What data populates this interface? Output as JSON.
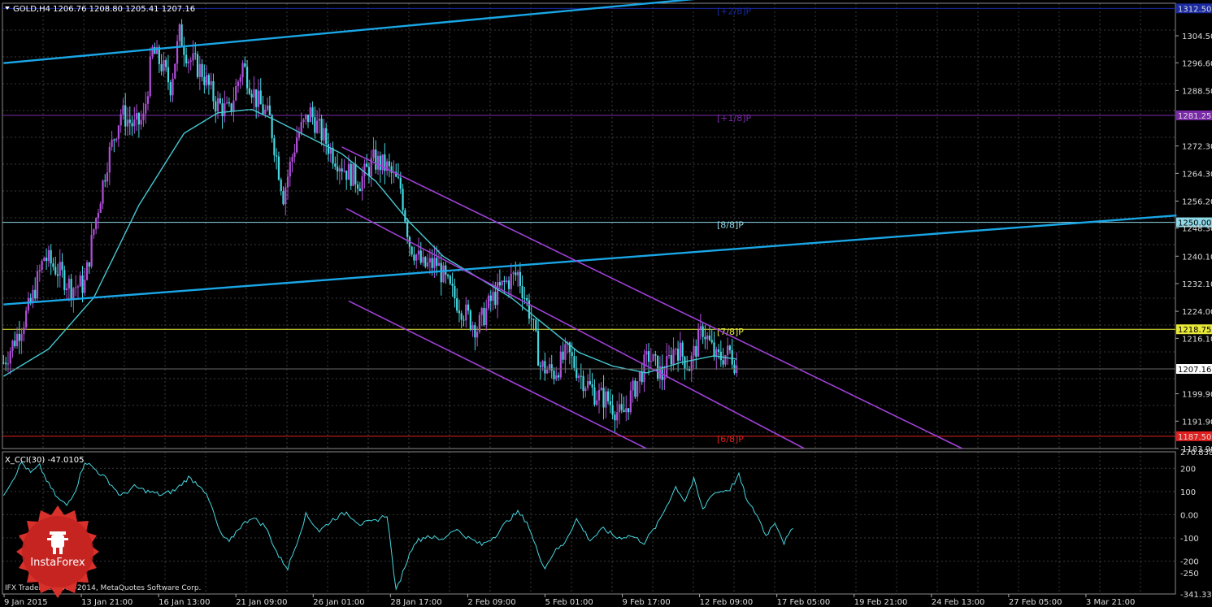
{
  "header": {
    "symbol_line": "GOLD,H4  1206.76 1208.80 1205.41 1207.16",
    "indicator_line": "X_CCI(30) -47.0105",
    "copyright": "IFX Trader, © 2001-2014, MetaQuotes Software Corp."
  },
  "logo": {
    "text": "InstaForex"
  },
  "colors": {
    "background": "#000000",
    "grid": "#3a3a3a",
    "bull_candle": "#b04fd8",
    "bear_candle": "#46d7e0",
    "moving_average": "#46c8d2",
    "trend_line": "#1aa6e6",
    "channel": "#a040d8",
    "cci": "#46d7e0",
    "level_1218": "#e8e83a",
    "level_1187": "#e02020",
    "level_1281": "#7a2aa8",
    "level_1312": "#1a2aa0",
    "current_price": "#b0b0b0"
  },
  "chart_data": [
    {
      "type": "candlestick",
      "title": "GOLD,H4",
      "ohlc_last": {
        "open": 1206.76,
        "high": 1208.8,
        "low": 1205.41,
        "close": 1207.16
      },
      "ylim": [
        1183.9,
        1314.0
      ],
      "y_ticks": [
        "1304.50",
        "1296.60",
        "1288.50",
        "1281.25",
        "1272.30",
        "1264.30",
        "1256.20",
        "1248.30",
        "1240.10",
        "1232.10",
        "1224.00",
        "1216.10",
        "1207.16",
        "1199.90",
        "1191.90",
        "1183.90"
      ],
      "x_ticks": [
        "9 Jan 2015",
        "13 Jan 21:00",
        "16 Jan 13:00",
        "21 Jan 09:00",
        "26 Jan 01:00",
        "28 Jan 17:00",
        "2 Feb 09:00",
        "5 Feb 01:00",
        "9 Feb 17:00",
        "12 Feb 09:00",
        "17 Feb 05:00",
        "19 Feb 21:00",
        "24 Feb 13:00",
        "27 Feb 05:00",
        "3 Mar 21:00"
      ],
      "price_path": [
        [
          0,
          1209
        ],
        [
          6,
          1217
        ],
        [
          12,
          1226
        ],
        [
          18,
          1240
        ],
        [
          24,
          1236
        ],
        [
          30,
          1231
        ],
        [
          36,
          1232
        ],
        [
          40,
          1248
        ],
        [
          46,
          1268
        ],
        [
          52,
          1282
        ],
        [
          58,
          1278
        ],
        [
          62,
          1280
        ],
        [
          66,
          1300
        ],
        [
          70,
          1296
        ],
        [
          74,
          1290
        ],
        [
          78,
          1305
        ],
        [
          82,
          1298
        ],
        [
          88,
          1294
        ],
        [
          94,
          1285
        ],
        [
          100,
          1282
        ],
        [
          106,
          1296
        ],
        [
          112,
          1286
        ],
        [
          118,
          1280
        ],
        [
          124,
          1258
        ],
        [
          130,
          1275
        ],
        [
          136,
          1282
        ],
        [
          140,
          1277
        ],
        [
          146,
          1270
        ],
        [
          152,
          1265
        ],
        [
          158,
          1262
        ],
        [
          164,
          1268
        ],
        [
          170,
          1266
        ],
        [
          176,
          1260
        ],
        [
          180,
          1244
        ],
        [
          186,
          1237
        ],
        [
          192,
          1238
        ],
        [
          198,
          1230
        ],
        [
          204,
          1224
        ],
        [
          210,
          1219
        ],
        [
          216,
          1227
        ],
        [
          222,
          1232
        ],
        [
          228,
          1235
        ],
        [
          234,
          1222
        ],
        [
          238,
          1208
        ],
        [
          244,
          1206
        ],
        [
          250,
          1212
        ],
        [
          256,
          1205
        ],
        [
          262,
          1200
        ],
        [
          268,
          1198
        ],
        [
          274,
          1193
        ],
        [
          280,
          1202
        ],
        [
          286,
          1211
        ],
        [
          292,
          1205
        ],
        [
          298,
          1214
        ],
        [
          304,
          1208
        ],
        [
          310,
          1219
        ],
        [
          316,
          1210
        ],
        [
          322,
          1212
        ],
        [
          325,
          1208
        ]
      ],
      "moving_average": [
        [
          0,
          1205
        ],
        [
          20,
          1213
        ],
        [
          40,
          1228
        ],
        [
          60,
          1255
        ],
        [
          80,
          1276
        ],
        [
          95,
          1282
        ],
        [
          110,
          1283
        ],
        [
          120,
          1280
        ],
        [
          135,
          1275
        ],
        [
          150,
          1270
        ],
        [
          165,
          1262
        ],
        [
          180,
          1250
        ],
        [
          195,
          1240
        ],
        [
          210,
          1234
        ],
        [
          225,
          1228
        ],
        [
          240,
          1220
        ],
        [
          255,
          1212
        ],
        [
          270,
          1208
        ],
        [
          285,
          1206
        ],
        [
          300,
          1209
        ],
        [
          315,
          1211
        ],
        [
          325,
          1210
        ]
      ],
      "horizontal_levels": [
        {
          "price": 1312.5,
          "label": "1312.50",
          "tag": "[+2/8]P",
          "color": "#1a2aa0"
        },
        {
          "price": 1281.25,
          "label": "1281.25",
          "tag": "[+1/8]P",
          "color": "#7a2aa8"
        },
        {
          "price": 1250.0,
          "label": "1250.00",
          "tag": "[8/8]P",
          "color": "#8fd8e8"
        },
        {
          "price": 1218.75,
          "label": "1218.75",
          "tag": "[7/8]P",
          "color": "#e8e83a"
        },
        {
          "price": 1187.5,
          "label": "1187.50",
          "tag": "[6/8]P",
          "color": "#e02020"
        }
      ],
      "current_price": "1207.16",
      "trend_lines": [
        {
          "from": [
            0,
            1296.5
          ],
          "to": [
            360,
            1318.5
          ]
        },
        {
          "from": [
            0,
            1226.0
          ],
          "to": [
            520,
            1252.0
          ]
        }
      ],
      "channel_lines": [
        {
          "from": [
            150,
            1272.0
          ],
          "to": [
            425,
            1183.9
          ]
        },
        {
          "from": [
            152,
            1254.0
          ],
          "to": [
            355,
            1183.9
          ]
        },
        {
          "from": [
            153,
            1227.0
          ],
          "to": [
            285,
            1183.9
          ]
        }
      ]
    },
    {
      "type": "line",
      "title": "X_CCI(30) -47.0105",
      "ylim": [
        -341.331,
        270.8381
      ],
      "y_ticks": [
        "270.8381",
        "200",
        "100",
        "0.00",
        "-100",
        "-200",
        "-250",
        "-341.331"
      ],
      "values": [
        [
          0,
          90
        ],
        [
          4,
          150
        ],
        [
          8,
          225
        ],
        [
          12,
          180
        ],
        [
          16,
          210
        ],
        [
          20,
          130
        ],
        [
          24,
          70
        ],
        [
          28,
          40
        ],
        [
          32,
          110
        ],
        [
          36,
          230
        ],
        [
          40,
          200
        ],
        [
          46,
          150
        ],
        [
          52,
          80
        ],
        [
          58,
          120
        ],
        [
          64,
          100
        ],
        [
          70,
          85
        ],
        [
          76,
          105
        ],
        [
          82,
          160
        ],
        [
          88,
          120
        ],
        [
          92,
          40
        ],
        [
          96,
          -80
        ],
        [
          100,
          -120
        ],
        [
          104,
          -60
        ],
        [
          110,
          -10
        ],
        [
          116,
          -50
        ],
        [
          122,
          -180
        ],
        [
          126,
          -230
        ],
        [
          130,
          -120
        ],
        [
          134,
          0
        ],
        [
          140,
          -70
        ],
        [
          146,
          -20
        ],
        [
          152,
          10
        ],
        [
          158,
          -40
        ],
        [
          164,
          -30
        ],
        [
          170,
          0
        ],
        [
          174,
          -330
        ],
        [
          178,
          -220
        ],
        [
          182,
          -120
        ],
        [
          188,
          -90
        ],
        [
          194,
          -110
        ],
        [
          200,
          -60
        ],
        [
          206,
          -100
        ],
        [
          212,
          -130
        ],
        [
          218,
          -90
        ],
        [
          224,
          -20
        ],
        [
          228,
          10
        ],
        [
          232,
          -30
        ],
        [
          236,
          -140
        ],
        [
          240,
          -230
        ],
        [
          244,
          -160
        ],
        [
          248,
          -130
        ],
        [
          254,
          -20
        ],
        [
          260,
          -110
        ],
        [
          266,
          -60
        ],
        [
          272,
          -100
        ],
        [
          278,
          -90
        ],
        [
          284,
          -120
        ],
        [
          290,
          -40
        ],
        [
          294,
          40
        ],
        [
          298,
          120
        ],
        [
          302,
          60
        ],
        [
          306,
          150
        ],
        [
          310,
          20
        ],
        [
          314,
          90
        ],
        [
          318,
          100
        ],
        [
          322,
          110
        ],
        [
          326,
          170
        ],
        [
          330,
          50
        ],
        [
          334,
          0
        ],
        [
          338,
          -90
        ],
        [
          342,
          -30
        ],
        [
          346,
          -120
        ],
        [
          350,
          -60
        ]
      ]
    }
  ]
}
